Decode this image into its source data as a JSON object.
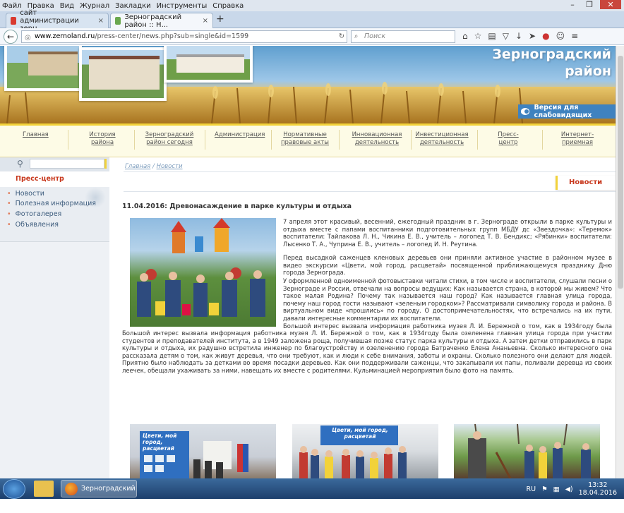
{
  "menubar": {
    "items": [
      "Файл",
      "Правка",
      "Вид",
      "Журнал",
      "Закладки",
      "Инструменты",
      "Справка"
    ]
  },
  "tabs": [
    {
      "label": "сайт администрации зерн...",
      "close": "×",
      "favicon_color": "#d93a2f"
    },
    {
      "label": "Зерноградский район :: Н...",
      "close": "×",
      "favicon_color": "#6aa84f"
    }
  ],
  "newtab": "+",
  "address": {
    "host": "www.zernoland.ru",
    "path": "/press-center/news.php?sub=single&id=1599",
    "search_placeholder": "Поиск"
  },
  "site": {
    "region_line1": "Зерноградский",
    "region_line2": "район",
    "accessibility": "Версия для слабовидящих"
  },
  "topnav": [
    "Главная",
    "История района",
    "Зерноградский район сегодня",
    "Администрация",
    "Нормативные правовые акты",
    "Инновационная деятельность",
    "Инвестиционная деятельность",
    "Пресс-центр",
    "Интернет-приемная"
  ],
  "sidebar": {
    "title": "Пресс-центр",
    "items": [
      "Новости",
      "Полезная информация",
      "Фотогалерея",
      "Объявления"
    ]
  },
  "breadcrumb": {
    "home": "Главная",
    "sep": "/",
    "current": "Новости"
  },
  "section_badge": "Новости",
  "article": {
    "title": "11.04.2016: Древонасаждение в парке культуры и отдыха",
    "p1": "7 апреля этот красивый, весенний, ежегодный праздник в г. Зернограде открыли в парке культуры и отдыха вместе с папами воспитанники подготовительных групп МБДУ дс «Звездочка»: «Теремок» воспитатели: Тайлакова Л. Н., Чикина Е. В., учитель – логопед Т. В. Бендикс; «Рябинки» воспитатели: Лысенко Т. А., Чуприна Е. В., учитель – логопед И. Н. Реутина.",
    "p2": "Перед высадкой саженцев кленовых деревьев они приняли активное участие в районном музее в видео экскурсии «Цвети, мой город, расцветай» посвященной приближающемуся празднику Дню города Зернограда.",
    "p3": "У оформленной одноименной фотовыставки читали стихи, в том числе и воспитатели, слушали песни о Зернограде и России, отвечали на вопросы ведущих: Как называется страна, в которой мы живем? Что такое малая Родина? Почему так называется наш город? Как называется главная улица города, почему наш город гости называют «зеленым городком»? Рассматривали символику города и района. В виртуальном виде «прошлись» по городу. О достопримечательностях, что встречались на их пути, давали интересные комментарии их воспитатели.",
    "p4": "Большой интерес вызвала информация работника музея Л. И. Бережной о том, как в 1934году была озеленена главная улица города при участии студентов и преподавателей института, а в 1949 заложена роща, получившая позже статус парка культуры и отдыха. А затем детки отправились в парк культуры и отдыха, их радушно встретила инженер по благоустройству и озеленению города Батраченко Елена Ананьевна. Сколько интересного она рассказала детям о том, как живут деревья, что они требуют, как и люди к себе внимания, заботы и охраны. Сколько полезного они делают для людей. Приятно было наблюдать за детками во время посадки деревьев. Как они поддерживали саженцы, что закапывали их папы, поливали деревца из своих леечек, обещали ухаживать за ними, навещать их вместе с родителями. Кульминацией мероприятия было фото на память.",
    "banner_text": "Цвети, мой город, расцветай"
  },
  "taskbar": {
    "app_label": "Зерноградский р...",
    "lang": "RU",
    "time": "13:32",
    "date": "18.04.2016"
  }
}
